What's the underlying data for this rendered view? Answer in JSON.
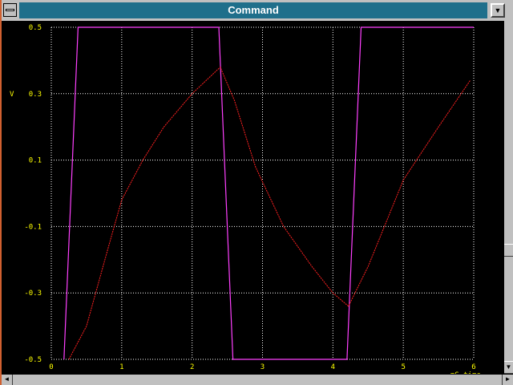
{
  "window": {
    "title": "Command",
    "minimize_glyph": "▼",
    "scroll_down_glyph": "▼",
    "scroll_left_glyph": "◄",
    "scroll_right_glyph": "►"
  },
  "chart_data": {
    "type": "line",
    "title": "",
    "xlabel": "mS  time",
    "ylabel": "V",
    "xlim": [
      0,
      6
    ],
    "ylim": [
      -0.5,
      0.5
    ],
    "x_ticks": [
      0,
      1,
      2,
      3,
      4,
      5,
      6
    ],
    "y_ticks": [
      -0.5,
      -0.3,
      -0.1,
      0.1,
      0.3,
      0.5
    ],
    "grid": true,
    "background": "#000000",
    "grid_color": "#ffffff",
    "label_color": "#ffff00",
    "series": [
      {
        "color": "#ff40ff",
        "x": [
          0.18,
          0.38,
          2.38,
          2.58,
          4.2,
          4.4,
          6.0
        ],
        "y": [
          -0.5,
          0.5,
          0.5,
          -0.5,
          -0.5,
          0.5,
          0.5
        ]
      },
      {
        "color": "#ff2020",
        "x": [
          0.25,
          0.5,
          0.8,
          1.0,
          1.3,
          1.6,
          2.0,
          2.4,
          2.6,
          2.9,
          3.3,
          3.7,
          4.0,
          4.22,
          4.5,
          5.0,
          5.5,
          5.95
        ],
        "y": [
          -0.5,
          -0.4,
          -0.17,
          -0.02,
          0.1,
          0.2,
          0.3,
          0.38,
          0.28,
          0.08,
          -0.1,
          -0.22,
          -0.3,
          -0.34,
          -0.22,
          0.04,
          0.2,
          0.34
        ]
      }
    ]
  }
}
